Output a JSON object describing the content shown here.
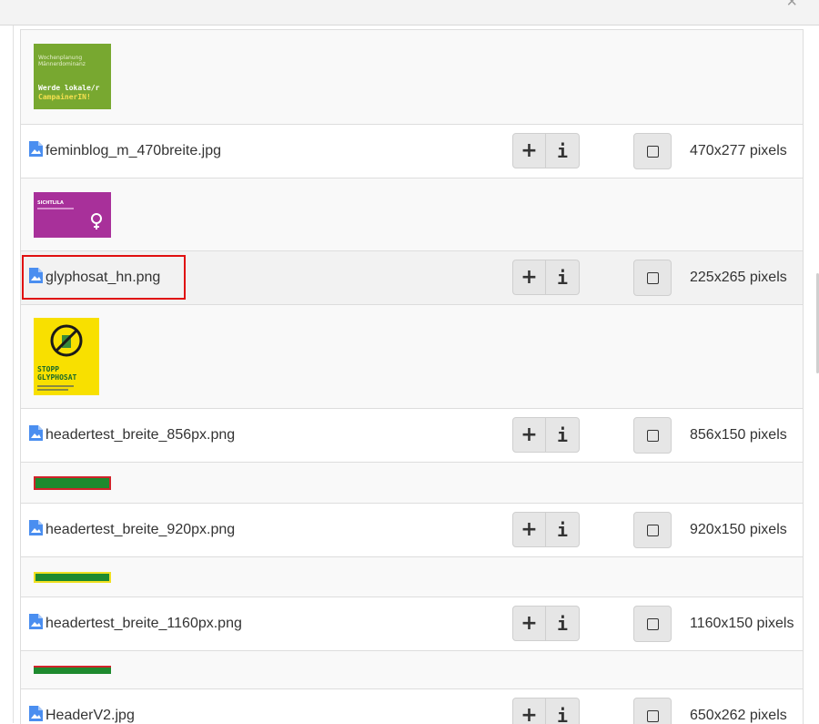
{
  "dialog": {
    "close_glyph": "×"
  },
  "files": [
    {
      "name": "feminblog_m_470breite.jpg",
      "dims": "470x277 pixels",
      "thumb": {
        "title_line1": "Wochenplanung",
        "title_line2": "Männerdominanz",
        "title_line3": "Werde lokale/r",
        "title_line4": "CampainerIN!",
        "bg": "#78a830"
      }
    },
    {
      "name": "glyphosat_hn.png",
      "dims": "225x265 pixels",
      "highlighted": true,
      "thumb": {
        "title_line1": "SICHTLILA",
        "bg": "#a8309a"
      }
    },
    {
      "name": "headertest_breite_856px.png",
      "dims": "856x150 pixels",
      "thumb": {
        "title_line1": "STOPP",
        "title_line2": "GLYPHOSAT",
        "bg": "#f8e000"
      }
    },
    {
      "name": "headertest_breite_920px.png",
      "dims": "920x150 pixels"
    },
    {
      "name": "headertest_breite_1160px.png",
      "dims": "1160x150 pixels"
    },
    {
      "name": "HeaderV2.jpg",
      "dims": "650x262 pixels"
    }
  ],
  "buttons": {
    "insert_label": "+",
    "info_label": "i"
  },
  "colors": {
    "highlight_border": "#e01010",
    "file_icon": "#4a8ef0",
    "header_green": "#1e8a2e",
    "header_red": "#d0232a",
    "header_yellow": "#f0e020"
  }
}
